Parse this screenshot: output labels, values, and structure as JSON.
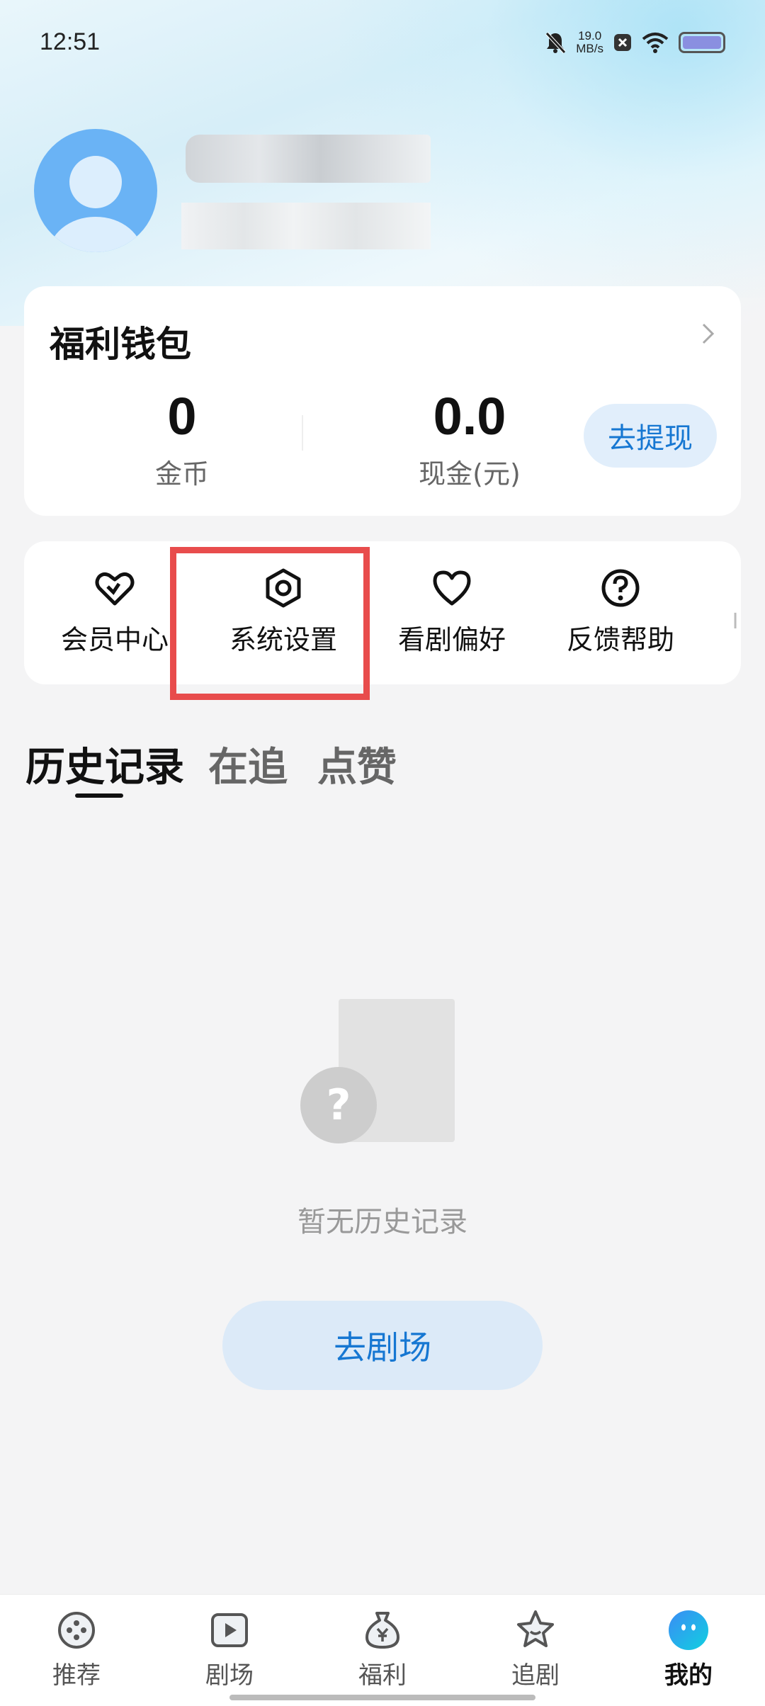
{
  "status_bar": {
    "time": "12:51",
    "net_speed_value": "19.0",
    "net_speed_unit": "MB/s",
    "icons": [
      "mute-bell-icon",
      "close-badge-icon",
      "wifi-icon",
      "battery-icon"
    ]
  },
  "profile": {
    "avatar_icon": "default-avatar-icon"
  },
  "wallet": {
    "title": "福利钱包",
    "coins_value": "0",
    "coins_label": "金币",
    "cash_value": "0.0",
    "cash_label": "现金(元)",
    "withdraw_label": "去提现"
  },
  "quick_menu": {
    "items": [
      {
        "label": "会员中心",
        "icon": "vip-heart-icon"
      },
      {
        "label": "系统设置",
        "icon": "settings-hex-icon"
      },
      {
        "label": "看剧偏好",
        "icon": "heart-icon"
      },
      {
        "label": "反馈帮助",
        "icon": "help-circle-icon"
      }
    ],
    "overflow_hint": "I"
  },
  "tabs": {
    "items": [
      {
        "label": "历史记录",
        "active": true
      },
      {
        "label": "在追",
        "active": false
      },
      {
        "label": "点赞",
        "active": false
      }
    ]
  },
  "empty_state": {
    "icon": "question-mark",
    "message": "暂无历史记录",
    "action_label": "去剧场"
  },
  "bottom_nav": {
    "items": [
      {
        "label": "推荐",
        "icon": "film-reel-icon",
        "active": false
      },
      {
        "label": "剧场",
        "icon": "play-icon",
        "active": false
      },
      {
        "label": "福利",
        "icon": "money-bag-icon",
        "active": false
      },
      {
        "label": "追剧",
        "icon": "star-icon",
        "active": false
      },
      {
        "label": "我的",
        "icon": "profile-face-icon",
        "active": true
      }
    ]
  },
  "colors": {
    "accent": "#1677d2",
    "highlight": "#e84c4c",
    "avatar": "#6ab3f5",
    "profile_active": "#1aa3f0"
  }
}
